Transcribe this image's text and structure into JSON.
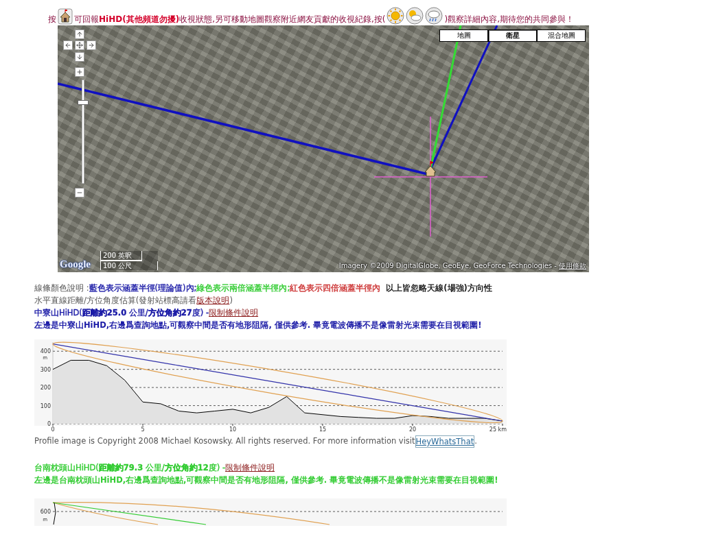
{
  "header": {
    "lead": "按",
    "middle": "可回報**HiHD(其他頻道勿擾)**收視狀態,另可移動地圖觀察附近網友貢獻的收視紀錄,按(",
    "tail": ")觀察詳細內容,期待您的共同參與！"
  },
  "map": {
    "map_types": [
      {
        "label": "地圖",
        "selected": false
      },
      {
        "label": "衛星",
        "selected": true
      },
      {
        "label": "混合地圖",
        "selected": false
      }
    ],
    "zoom": {
      "level": 0.8
    },
    "scale": {
      "imperial": "200 英呎",
      "metric": "100 公尺"
    },
    "logo": "Google",
    "attribution": "Imagery ©2009 DigitalGlobe, GeoEye, GeoForce Technologies - ",
    "terms_link": "使用條款"
  },
  "legend": {
    "label": "線條顏色說明 : ",
    "items": [
      {
        "text": "藍色表示涵蓋半徑(理論值)內;",
        "color": "#1a1aa6"
      },
      {
        "text": "綠色表示兩倍涵蓋半徑內;",
        "color": "#33cc33"
      },
      {
        "text": "紅色表示四倍涵蓋半徑內",
        "color": "#cc3333"
      }
    ],
    "remark": "以上皆忽略天線(場強)方向性"
  },
  "estimate": {
    "text": "水平直線距離/方位角度估算(發射站標高請看",
    "link": "版本說明",
    "tail": ")"
  },
  "stations": [
    {
      "color": "#1a1aa6",
      "title": "中寮山HiHD(**距離約25.0** 公里/**方位角約27**度) - ",
      "link": "限制條件說明",
      "note": "左邊是中寮山HiHD,右邊爲查詢地點,可觀察中間是否有地形阻隔, 僅供參考. 畢竟電波傳播不是像雷射光束需要在目視範圍!",
      "chart_data": {
        "type": "area",
        "grid": true,
        "ylabel": "m",
        "x": [
          0,
          1,
          2,
          3,
          4,
          5,
          6,
          7,
          8,
          9,
          10,
          11,
          12,
          13,
          14,
          15,
          16,
          17,
          18,
          19,
          20,
          21,
          22,
          23,
          24,
          25
        ],
        "series": [
          {
            "type": "area",
            "color": "#000000",
            "values": [
              300,
              350,
              350,
              320,
              240,
              120,
              110,
              70,
              60,
              70,
              80,
              60,
              90,
              150,
              60,
              50,
              40,
              35,
              30,
              30,
              45,
              40,
              30,
              30,
              30,
              15
            ]
          },
          {
            "type": "line",
            "color": "#3333aa",
            "values": [
              440,
              423,
              406,
              389,
              372,
              355,
              338,
              321,
              304,
              287,
              270,
              253,
              236,
              219,
              202,
              185,
              168,
              151,
              134,
              117,
              100,
              83,
              66,
              49,
              32,
              15
            ]
          }
        ],
        "xlim": [
          0,
          25
        ],
        "ylim": [
          0,
          450
        ],
        "xticks": [
          0,
          5,
          10,
          15,
          20,
          {
            "value": 25,
            "label": "25 km"
          }
        ],
        "yticks": [
          0,
          100,
          200,
          300,
          400
        ]
      },
      "credit": "Profile image is Copyright 2008 Michael Kosowsky. All rights reserved. For more information visit ",
      "credit_link": "HeyWhatsThat",
      "credit_tail": "."
    },
    {
      "color": "#33cc33",
      "title": "台南枕頭山HiHD(**距離約79.3** 公里/**方位角約12**度) - ",
      "link": "限制條件說明",
      "note": "左邊是台南枕頭山HiHD,右邊爲查詢地點,可觀察中間是否有地形阻隔, 僅供參考. 畢竟電波傳播不是像雷射光束需要在目視範圍!",
      "partial_chart": {
        "tick": "600",
        "unit": "m"
      }
    }
  ]
}
